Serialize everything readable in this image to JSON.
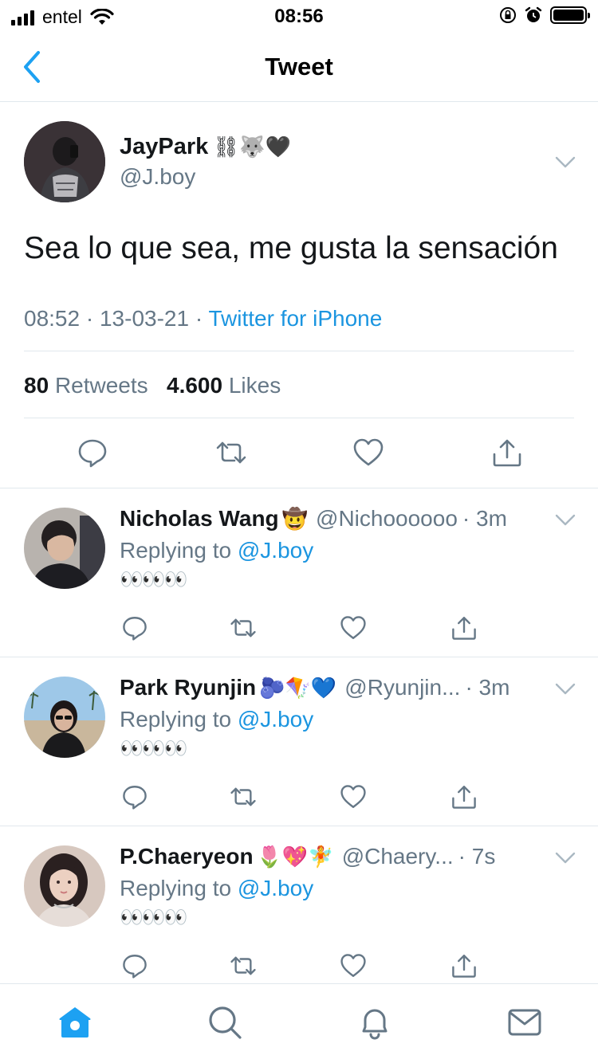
{
  "status_bar": {
    "carrier": "entel",
    "time": "08:56"
  },
  "nav": {
    "title": "Tweet"
  },
  "main_tweet": {
    "name": "JayPark",
    "name_emojis": "⛓🐺🖤",
    "handle": "@J.boy",
    "text": "Sea lo que sea, me gusta la sensación",
    "time": "08:52",
    "date": "13-03-21",
    "source": "Twitter for iPhone",
    "retweets_count": "80",
    "retweets_label": "Retweets",
    "likes_count": "4.600",
    "likes_label": "Likes"
  },
  "replies": [
    {
      "name": "Nicholas Wang",
      "name_emojis": "🤠",
      "handle": "@Nichoooooo",
      "time": "· 3m",
      "replying_label": "Replying to",
      "replying_handle": "@J.boy",
      "text": "👀👀👀"
    },
    {
      "name": "Park Ryunjin",
      "name_emojis": "🫐🪁💙",
      "handle": "@Ryunjin...",
      "time": "· 3m",
      "replying_label": "Replying to",
      "replying_handle": "@J.boy",
      "text": "👀👀👀"
    },
    {
      "name": "P.Chaeryeon",
      "name_emojis": "🌷💖🧚",
      "handle": "@Chaery...",
      "time": "· 7s",
      "replying_label": "Replying to",
      "replying_handle": "@J.boy",
      "text": "👀👀👀"
    }
  ],
  "colors": {
    "accent": "#1b95e0",
    "muted": "#657786",
    "divider": "#e1e8ed",
    "tab_active": "#1da1f2"
  },
  "icons": {
    "actions": [
      "reply-icon",
      "retweet-icon",
      "like-icon",
      "share-icon"
    ],
    "tabs": [
      "home-icon",
      "search-icon",
      "notifications-icon",
      "messages-icon"
    ]
  }
}
